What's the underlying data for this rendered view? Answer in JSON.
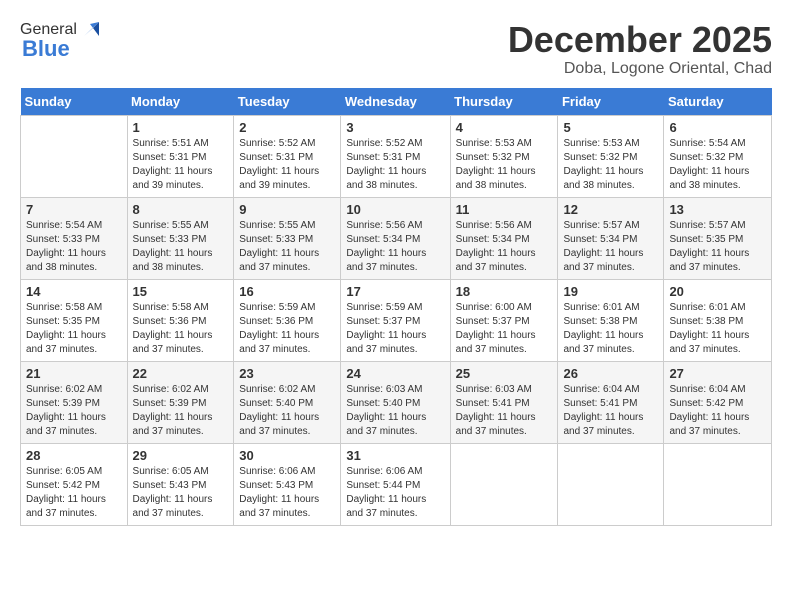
{
  "logo": {
    "general": "General",
    "blue": "Blue"
  },
  "title": "December 2025",
  "location": "Doba, Logone Oriental, Chad",
  "days_header": [
    "Sunday",
    "Monday",
    "Tuesday",
    "Wednesday",
    "Thursday",
    "Friday",
    "Saturday"
  ],
  "weeks": [
    [
      {
        "day": "",
        "info": ""
      },
      {
        "day": "1",
        "info": "Sunrise: 5:51 AM\nSunset: 5:31 PM\nDaylight: 11 hours\nand 39 minutes."
      },
      {
        "day": "2",
        "info": "Sunrise: 5:52 AM\nSunset: 5:31 PM\nDaylight: 11 hours\nand 39 minutes."
      },
      {
        "day": "3",
        "info": "Sunrise: 5:52 AM\nSunset: 5:31 PM\nDaylight: 11 hours\nand 38 minutes."
      },
      {
        "day": "4",
        "info": "Sunrise: 5:53 AM\nSunset: 5:32 PM\nDaylight: 11 hours\nand 38 minutes."
      },
      {
        "day": "5",
        "info": "Sunrise: 5:53 AM\nSunset: 5:32 PM\nDaylight: 11 hours\nand 38 minutes."
      },
      {
        "day": "6",
        "info": "Sunrise: 5:54 AM\nSunset: 5:32 PM\nDaylight: 11 hours\nand 38 minutes."
      }
    ],
    [
      {
        "day": "7",
        "info": "Sunrise: 5:54 AM\nSunset: 5:33 PM\nDaylight: 11 hours\nand 38 minutes."
      },
      {
        "day": "8",
        "info": "Sunrise: 5:55 AM\nSunset: 5:33 PM\nDaylight: 11 hours\nand 38 minutes."
      },
      {
        "day": "9",
        "info": "Sunrise: 5:55 AM\nSunset: 5:33 PM\nDaylight: 11 hours\nand 37 minutes."
      },
      {
        "day": "10",
        "info": "Sunrise: 5:56 AM\nSunset: 5:34 PM\nDaylight: 11 hours\nand 37 minutes."
      },
      {
        "day": "11",
        "info": "Sunrise: 5:56 AM\nSunset: 5:34 PM\nDaylight: 11 hours\nand 37 minutes."
      },
      {
        "day": "12",
        "info": "Sunrise: 5:57 AM\nSunset: 5:34 PM\nDaylight: 11 hours\nand 37 minutes."
      },
      {
        "day": "13",
        "info": "Sunrise: 5:57 AM\nSunset: 5:35 PM\nDaylight: 11 hours\nand 37 minutes."
      }
    ],
    [
      {
        "day": "14",
        "info": "Sunrise: 5:58 AM\nSunset: 5:35 PM\nDaylight: 11 hours\nand 37 minutes."
      },
      {
        "day": "15",
        "info": "Sunrise: 5:58 AM\nSunset: 5:36 PM\nDaylight: 11 hours\nand 37 minutes."
      },
      {
        "day": "16",
        "info": "Sunrise: 5:59 AM\nSunset: 5:36 PM\nDaylight: 11 hours\nand 37 minutes."
      },
      {
        "day": "17",
        "info": "Sunrise: 5:59 AM\nSunset: 5:37 PM\nDaylight: 11 hours\nand 37 minutes."
      },
      {
        "day": "18",
        "info": "Sunrise: 6:00 AM\nSunset: 5:37 PM\nDaylight: 11 hours\nand 37 minutes."
      },
      {
        "day": "19",
        "info": "Sunrise: 6:01 AM\nSunset: 5:38 PM\nDaylight: 11 hours\nand 37 minutes."
      },
      {
        "day": "20",
        "info": "Sunrise: 6:01 AM\nSunset: 5:38 PM\nDaylight: 11 hours\nand 37 minutes."
      }
    ],
    [
      {
        "day": "21",
        "info": "Sunrise: 6:02 AM\nSunset: 5:39 PM\nDaylight: 11 hours\nand 37 minutes."
      },
      {
        "day": "22",
        "info": "Sunrise: 6:02 AM\nSunset: 5:39 PM\nDaylight: 11 hours\nand 37 minutes."
      },
      {
        "day": "23",
        "info": "Sunrise: 6:02 AM\nSunset: 5:40 PM\nDaylight: 11 hours\nand 37 minutes."
      },
      {
        "day": "24",
        "info": "Sunrise: 6:03 AM\nSunset: 5:40 PM\nDaylight: 11 hours\nand 37 minutes."
      },
      {
        "day": "25",
        "info": "Sunrise: 6:03 AM\nSunset: 5:41 PM\nDaylight: 11 hours\nand 37 minutes."
      },
      {
        "day": "26",
        "info": "Sunrise: 6:04 AM\nSunset: 5:41 PM\nDaylight: 11 hours\nand 37 minutes."
      },
      {
        "day": "27",
        "info": "Sunrise: 6:04 AM\nSunset: 5:42 PM\nDaylight: 11 hours\nand 37 minutes."
      }
    ],
    [
      {
        "day": "28",
        "info": "Sunrise: 6:05 AM\nSunset: 5:42 PM\nDaylight: 11 hours\nand 37 minutes."
      },
      {
        "day": "29",
        "info": "Sunrise: 6:05 AM\nSunset: 5:43 PM\nDaylight: 11 hours\nand 37 minutes."
      },
      {
        "day": "30",
        "info": "Sunrise: 6:06 AM\nSunset: 5:43 PM\nDaylight: 11 hours\nand 37 minutes."
      },
      {
        "day": "31",
        "info": "Sunrise: 6:06 AM\nSunset: 5:44 PM\nDaylight: 11 hours\nand 37 minutes."
      },
      {
        "day": "",
        "info": ""
      },
      {
        "day": "",
        "info": ""
      },
      {
        "day": "",
        "info": ""
      }
    ]
  ]
}
